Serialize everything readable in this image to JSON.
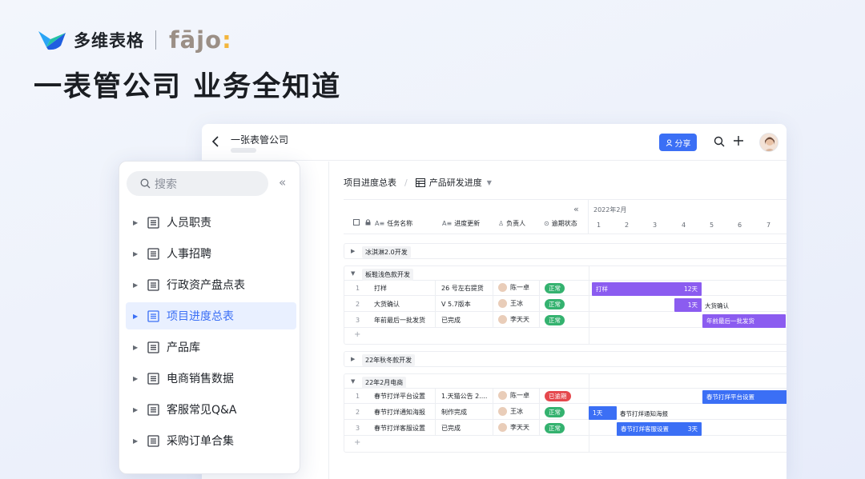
{
  "brand": {
    "name": "多维表格",
    "partner": "fājo",
    "partner_colon": ":"
  },
  "headline": "一表管公司 业务全知道",
  "window": {
    "title": "一张表管公司",
    "share_label": "分享"
  },
  "view": {
    "table_name": "项目进度总表",
    "view_name": "产品研发进度"
  },
  "columns": [
    "任务名称",
    "进度更新",
    "负责人",
    "逾期状态"
  ],
  "gantt": {
    "month": "2022年2月",
    "days": [
      "1",
      "2",
      "3",
      "4",
      "5",
      "6",
      "7"
    ]
  },
  "groups": [
    {
      "label": "冰淇淋2.0开发",
      "collapsed": true,
      "rows": []
    },
    {
      "label": "板鞋浅色款开发",
      "collapsed": false,
      "rows": [
        {
          "num": "1",
          "task": "打样",
          "progress": "26 号左右提货",
          "owner": "陈一卓",
          "status": "正常",
          "status_type": "ok"
        },
        {
          "num": "2",
          "task": "大货确认",
          "progress": "V 5.7版本",
          "owner": "王冰",
          "status": "正常",
          "status_type": "ok"
        },
        {
          "num": "3",
          "task": "年前最后一批发货",
          "progress": "已完成",
          "owner": "李天天",
          "status": "正常",
          "status_type": "ok"
        }
      ]
    },
    {
      "label": "22年秋冬款开发",
      "collapsed": true,
      "rows": []
    },
    {
      "label": "22年2月电商",
      "collapsed": false,
      "rows": [
        {
          "num": "1",
          "task": "春节打烊平台设置",
          "progress": "1.天猫公告 2....",
          "owner": "陈一卓",
          "status": "已逾期",
          "status_type": "late"
        },
        {
          "num": "2",
          "task": "春节打烊通知海报",
          "progress": "制作完成",
          "owner": "王冰",
          "status": "正常",
          "status_type": "ok"
        },
        {
          "num": "3",
          "task": "春节打烊客服设置",
          "progress": "已完成",
          "owner": "李天天",
          "status": "正常",
          "status_type": "ok"
        }
      ]
    }
  ],
  "bars": {
    "b1": {
      "label": "打样",
      "days": "12天"
    },
    "b2": {
      "label": "",
      "days": "1天",
      "after": "大货确认"
    },
    "b3": {
      "label": "年前最后一批发货"
    },
    "b4": {
      "label": "春节打烊平台设置"
    },
    "b5": {
      "label": "",
      "days": "1天",
      "after": "春节打烊通知海报"
    },
    "b6": {
      "label": "春节打烊客服设置",
      "days": "3天"
    }
  },
  "sidebar": {
    "search_placeholder": "搜索",
    "items": [
      {
        "label": "人员职责"
      },
      {
        "label": "人事招聘"
      },
      {
        "label": "行政资产盘点表"
      },
      {
        "label": "项目进度总表",
        "active": true
      },
      {
        "label": "产品库"
      },
      {
        "label": "电商销售数据"
      },
      {
        "label": "客服常见Q&A"
      },
      {
        "label": "采购订单合集"
      }
    ]
  },
  "colors": {
    "accent": "#3b6ff5",
    "bar_purple": "#8b5cf0",
    "ok": "#34b26f",
    "late": "#e5484d"
  }
}
